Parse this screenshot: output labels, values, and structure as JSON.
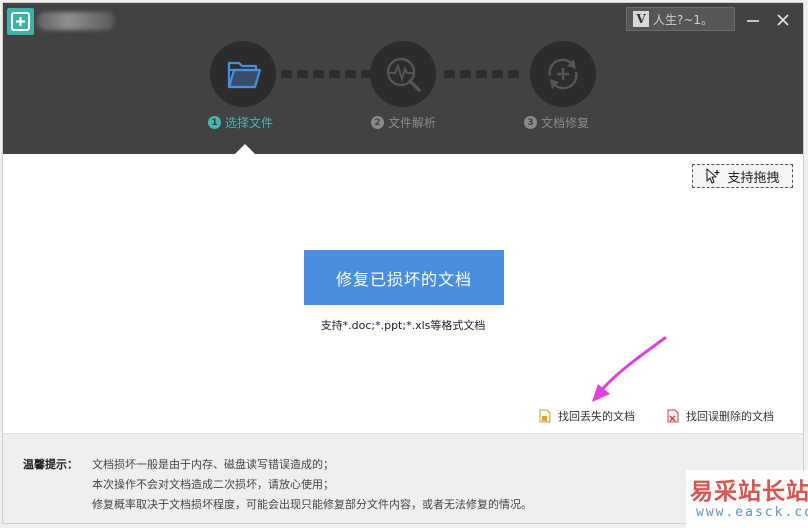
{
  "window": {
    "user_badge_letter": "V",
    "user_name": "人生?~1。"
  },
  "steps": [
    {
      "num": "1",
      "label": "选择文件",
      "state": "active"
    },
    {
      "num": "2",
      "label": "文件解析",
      "state": "inactive"
    },
    {
      "num": "3",
      "label": "文档修复",
      "state": "inactive"
    }
  ],
  "drag_hint": "支持拖拽",
  "main_button": "修复已损坏的文档",
  "supported_formats": "支持*.doc;*.ppt;*.xls等格式文档",
  "links": {
    "recover_lost": "找回丢失的文档",
    "recover_deleted": "找回误删除的文档"
  },
  "tips": {
    "title": "温馨提示：",
    "lines": [
      "文档损坏一般是由于内存、磁盘读写错误造成的；",
      "本次操作不会对文档造成二次损坏，请放心使用；",
      "修复概率取决于文档损坏程度，可能会出现只能修复部分文件内容，或者无法修复的情况。"
    ]
  },
  "watermark": {
    "text": "易采站长站",
    "url": "www.easck.com"
  },
  "colors": {
    "accent_teal": "#45b8ad",
    "primary_button": "#4a8ee0",
    "header_bg": "#424242",
    "annotation_arrow": "#e23fe0"
  }
}
